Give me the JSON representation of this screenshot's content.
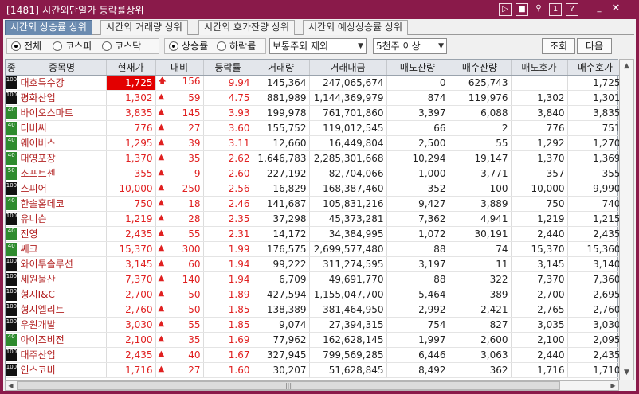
{
  "window": {
    "title": "[1481] 시간외단일가 등락률상위"
  },
  "titlebar_buttons": [
    "link-icon",
    "window-icon",
    "pin-icon",
    "help-icon",
    "info-icon",
    "minimize-icon",
    "close-icon"
  ],
  "tabs": [
    {
      "label": "시간외 상승률 상위",
      "active": true
    },
    {
      "label": "시간외 거래량 상위",
      "active": false
    },
    {
      "label": "시간외 호가잔량 상위",
      "active": false
    },
    {
      "label": "시간외 예상상승률 상위",
      "active": false
    }
  ],
  "market": {
    "options": [
      "전체",
      "코스피",
      "코스닥"
    ],
    "selected": "전체"
  },
  "direction": {
    "options": [
      "상승률",
      "하락률"
    ],
    "selected": "상승률"
  },
  "filter_select": {
    "value": "보통주외 제외"
  },
  "volume_select": {
    "value": "5천주 이상"
  },
  "buttons": {
    "query": "조회",
    "next": "다음"
  },
  "columns": [
    "종",
    "종목명",
    "현재가",
    "대비",
    "등락률",
    "거래량",
    "거래대금",
    "매도잔량",
    "매수잔량",
    "매도호가",
    "매수호가"
  ],
  "rows": [
    {
      "badge": "100",
      "name": "대호특수강",
      "price": "1,725",
      "price_hi": true,
      "arrow": "up-bold",
      "change": "156",
      "rate": "9.94",
      "volume": "145,364",
      "amount": "247,065,674",
      "ask_qty": "0",
      "bid_qty": "625,743",
      "ask": "",
      "bid": "1,725"
    },
    {
      "badge": "100",
      "name": "평화산업",
      "price": "1,302",
      "arrow": "up",
      "change": "59",
      "rate": "4.75",
      "volume": "881,989",
      "amount": "1,144,369,979",
      "ask_qty": "874",
      "bid_qty": "119,976",
      "ask": "1,302",
      "bid": "1,301"
    },
    {
      "badge": "40",
      "name": "바이오스마트",
      "price": "3,835",
      "arrow": "up",
      "change": "145",
      "rate": "3.93",
      "volume": "199,978",
      "amount": "761,701,860",
      "ask_qty": "3,397",
      "bid_qty": "6,088",
      "ask": "3,840",
      "bid": "3,835"
    },
    {
      "badge": "40",
      "name": "티비씨",
      "price": "776",
      "arrow": "up",
      "change": "27",
      "rate": "3.60",
      "volume": "155,752",
      "amount": "119,012,545",
      "ask_qty": "66",
      "bid_qty": "2",
      "ask": "776",
      "bid": "751"
    },
    {
      "badge": "40",
      "name": "웨이버스",
      "price": "1,295",
      "arrow": "up",
      "change": "39",
      "rate": "3.11",
      "volume": "12,660",
      "amount": "16,449,804",
      "ask_qty": "2,500",
      "bid_qty": "55",
      "ask": "1,292",
      "bid": "1,270"
    },
    {
      "badge": "40",
      "name": "대영포장",
      "price": "1,370",
      "arrow": "up",
      "change": "35",
      "rate": "2.62",
      "volume": "1,646,783",
      "amount": "2,285,301,668",
      "ask_qty": "10,294",
      "bid_qty": "19,147",
      "ask": "1,370",
      "bid": "1,369"
    },
    {
      "badge": "50",
      "name": "소프트센",
      "price": "355",
      "arrow": "up",
      "change": "9",
      "rate": "2.60",
      "volume": "227,192",
      "amount": "82,704,066",
      "ask_qty": "1,000",
      "bid_qty": "3,771",
      "ask": "357",
      "bid": "355"
    },
    {
      "badge": "100",
      "name": "스피어",
      "price": "10,000",
      "arrow": "up",
      "change": "250",
      "rate": "2.56",
      "volume": "16,829",
      "amount": "168,387,460",
      "ask_qty": "352",
      "bid_qty": "100",
      "ask": "10,000",
      "bid": "9,990"
    },
    {
      "badge": "40",
      "name": "한솔홈데코",
      "price": "750",
      "arrow": "up",
      "change": "18",
      "rate": "2.46",
      "volume": "141,687",
      "amount": "105,831,216",
      "ask_qty": "9,427",
      "bid_qty": "3,889",
      "ask": "750",
      "bid": "740"
    },
    {
      "badge": "100",
      "name": "유니슨",
      "price": "1,219",
      "arrow": "up",
      "change": "28",
      "rate": "2.35",
      "volume": "37,298",
      "amount": "45,373,281",
      "ask_qty": "7,362",
      "bid_qty": "4,941",
      "ask": "1,219",
      "bid": "1,215"
    },
    {
      "badge": "40",
      "name": "진영",
      "price": "2,435",
      "arrow": "up",
      "change": "55",
      "rate": "2.31",
      "volume": "14,172",
      "amount": "34,384,995",
      "ask_qty": "1,072",
      "bid_qty": "30,191",
      "ask": "2,440",
      "bid": "2,435"
    },
    {
      "badge": "40",
      "name": "쎄크",
      "price": "15,370",
      "arrow": "up",
      "change": "300",
      "rate": "1.99",
      "volume": "176,575",
      "amount": "2,699,577,480",
      "ask_qty": "88",
      "bid_qty": "74",
      "ask": "15,370",
      "bid": "15,360"
    },
    {
      "badge": "100",
      "name": "와이투솔루션",
      "price": "3,145",
      "arrow": "up",
      "change": "60",
      "rate": "1.94",
      "volume": "99,222",
      "amount": "311,274,595",
      "ask_qty": "3,197",
      "bid_qty": "11",
      "ask": "3,145",
      "bid": "3,140"
    },
    {
      "badge": "100",
      "name": "세원물산",
      "price": "7,370",
      "arrow": "up",
      "change": "140",
      "rate": "1.94",
      "volume": "6,709",
      "amount": "49,691,770",
      "ask_qty": "88",
      "bid_qty": "322",
      "ask": "7,370",
      "bid": "7,360"
    },
    {
      "badge": "100",
      "name": "형지I&C",
      "price": "2,700",
      "arrow": "up",
      "change": "50",
      "rate": "1.89",
      "volume": "427,594",
      "amount": "1,155,047,700",
      "ask_qty": "5,464",
      "bid_qty": "389",
      "ask": "2,700",
      "bid": "2,695"
    },
    {
      "badge": "100",
      "name": "형지엘리트",
      "price": "2,760",
      "arrow": "up",
      "change": "50",
      "rate": "1.85",
      "volume": "138,389",
      "amount": "381,464,950",
      "ask_qty": "2,992",
      "bid_qty": "2,421",
      "ask": "2,765",
      "bid": "2,760"
    },
    {
      "badge": "100",
      "name": "우원개발",
      "price": "3,030",
      "arrow": "up",
      "change": "55",
      "rate": "1.85",
      "volume": "9,074",
      "amount": "27,394,315",
      "ask_qty": "754",
      "bid_qty": "827",
      "ask": "3,035",
      "bid": "3,030"
    },
    {
      "badge": "40",
      "name": "아이즈비전",
      "price": "2,100",
      "arrow": "up",
      "change": "35",
      "rate": "1.69",
      "volume": "77,962",
      "amount": "162,628,145",
      "ask_qty": "1,997",
      "bid_qty": "2,600",
      "ask": "2,100",
      "bid": "2,095"
    },
    {
      "badge": "100",
      "name": "대주산업",
      "price": "2,435",
      "arrow": "up",
      "change": "40",
      "rate": "1.67",
      "volume": "327,945",
      "amount": "799,569,285",
      "ask_qty": "6,446",
      "bid_qty": "3,063",
      "ask": "2,440",
      "bid": "2,435"
    },
    {
      "badge": "100",
      "name": "인스코비",
      "price": "1,716",
      "arrow": "up",
      "change": "27",
      "rate": "1.60",
      "volume": "30,207",
      "amount": "51,628,845",
      "ask_qty": "8,492",
      "bid_qty": "362",
      "ask": "1,716",
      "bid": "1,710"
    }
  ],
  "colors": {
    "titlebar": "#8a1a4a",
    "active_tab": "#6b8bb0",
    "price_highlight": "#e30000",
    "up": "#e02020",
    "name": "#b22222"
  }
}
